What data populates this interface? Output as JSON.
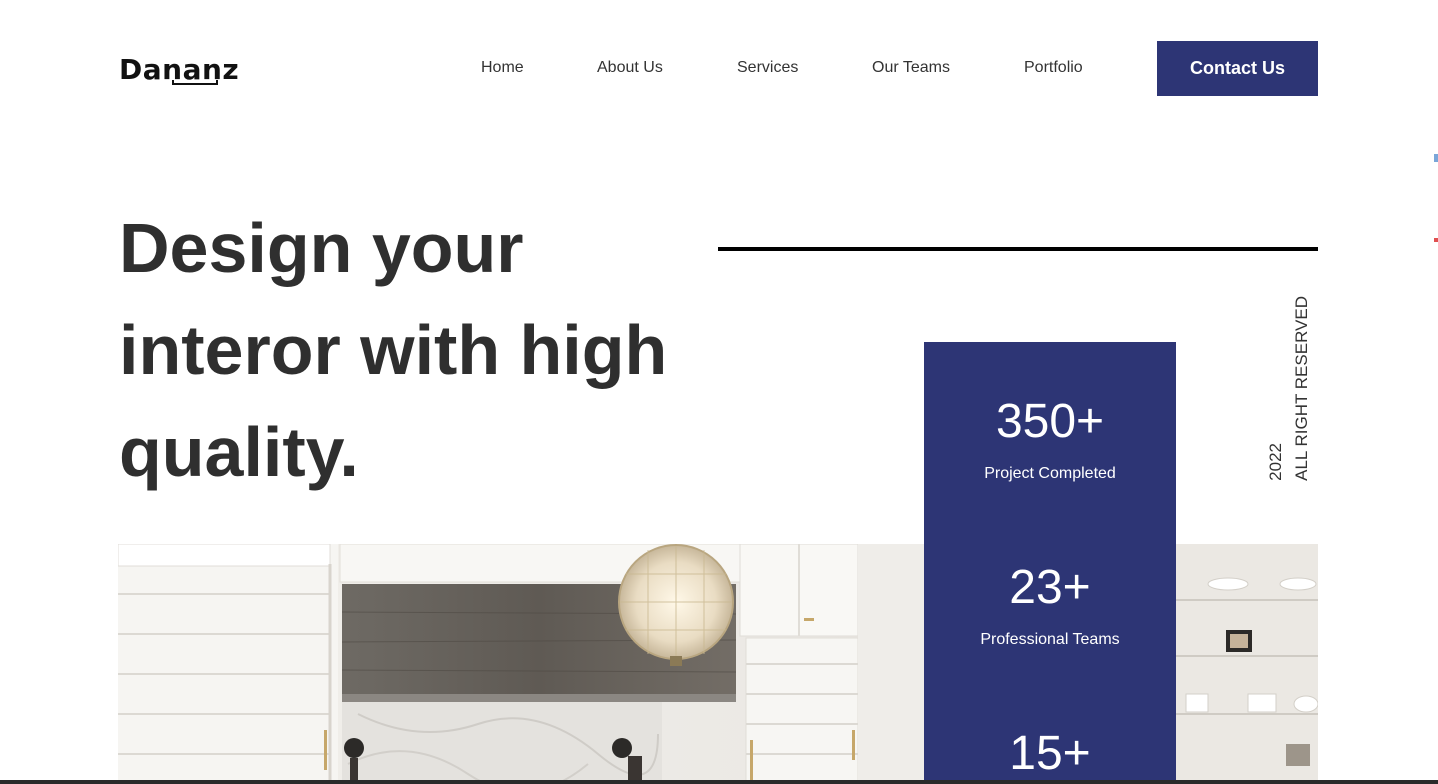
{
  "header": {
    "logo": "Dananz",
    "nav": [
      "Home",
      "About Us",
      "Services",
      "Our Teams",
      "Portfolio"
    ],
    "cta_label": "Contact Us"
  },
  "hero": {
    "title_lines": [
      "Design your",
      "interor with high",
      "quality."
    ],
    "year": "2022",
    "rights": "ALL RIGHT RESERVED"
  },
  "stats": [
    {
      "value": "350+",
      "label": "Project Completed"
    },
    {
      "value": "23+",
      "label": "Professional Teams"
    },
    {
      "value": "15+",
      "label": ""
    }
  ],
  "colors": {
    "accent": "#2d3575",
    "text": "#2f2f2f",
    "background": "#ffffff"
  }
}
